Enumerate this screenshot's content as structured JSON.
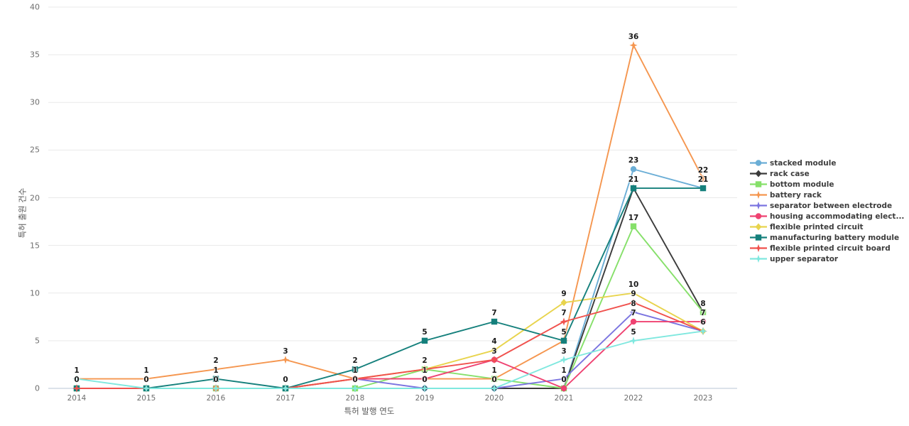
{
  "chart_data": {
    "type": "line",
    "title": "",
    "xlabel": "특허 발행 연도",
    "ylabel": "특허 출원 건수",
    "categories": [
      "2014",
      "2015",
      "2016",
      "2017",
      "2018",
      "2019",
      "2020",
      "2021",
      "2022",
      "2023"
    ],
    "x": [
      2014,
      2015,
      2016,
      2017,
      2018,
      2019,
      2020,
      2021,
      2022,
      2023
    ],
    "ylim": [
      0,
      40
    ],
    "yticks": [
      0,
      5,
      10,
      15,
      20,
      25,
      30,
      35,
      40
    ],
    "grid": true,
    "legend_position": "right",
    "series": [
      {
        "name": "stacked module",
        "color": "#6baed6",
        "marker": "circle",
        "values": [
          0,
          0,
          0,
          0,
          0,
          0,
          0,
          0,
          23,
          21
        ]
      },
      {
        "name": "rack case",
        "color": "#3b3b3b",
        "marker": "diamond",
        "values": [
          0,
          0,
          0,
          0,
          0,
          0,
          0,
          0,
          21,
          8
        ]
      },
      {
        "name": "bottom module",
        "color": "#86e06a",
        "marker": "square",
        "values": [
          0,
          0,
          0,
          0,
          0,
          2,
          1,
          0,
          17,
          8
        ]
      },
      {
        "name": "battery rack",
        "color": "#f5964f",
        "marker": "star",
        "values": [
          1,
          1,
          2,
          3,
          1,
          1,
          1,
          5,
          36,
          22
        ]
      },
      {
        "name": "separator between electrode",
        "color": "#7b74e0",
        "marker": "star",
        "values": [
          0,
          0,
          0,
          0,
          1,
          0,
          0,
          1,
          8,
          6
        ]
      },
      {
        "name": "housing accommodating elect...",
        "color": "#ef4271",
        "marker": "circle",
        "values": [
          0,
          0,
          0,
          0,
          1,
          1,
          3,
          0,
          7,
          7
        ]
      },
      {
        "name": "flexible printed circuit",
        "color": "#e8d44d",
        "marker": "diamond",
        "values": [
          0,
          0,
          0,
          0,
          1,
          2,
          4,
          9,
          10,
          6
        ]
      },
      {
        "name": "manufacturing battery module",
        "color": "#15807c",
        "marker": "square",
        "values": [
          0,
          0,
          1,
          0,
          2,
          5,
          7,
          5,
          21,
          21
        ]
      },
      {
        "name": "flexible printed circuit board",
        "color": "#f0514d",
        "marker": "star",
        "values": [
          0,
          0,
          0,
          0,
          1,
          2,
          3,
          7,
          9,
          6
        ]
      },
      {
        "name": "upper separator",
        "color": "#7fe8df",
        "marker": "star",
        "values": [
          1,
          0,
          0,
          0,
          0,
          0,
          0,
          3,
          5,
          6
        ]
      }
    ],
    "point_labels": {
      "2014": [
        "1",
        "0"
      ],
      "2015": [
        "1",
        "0"
      ],
      "2016": [
        "2",
        "1",
        "0"
      ],
      "2017": [
        "3",
        "0"
      ],
      "2018": [
        "2",
        "1",
        "0"
      ],
      "2019": [
        "5",
        "2",
        "1",
        "0"
      ],
      "2020": [
        "7",
        "4",
        "3",
        "1",
        "0"
      ],
      "2021": [
        "9",
        "7",
        "5",
        "3",
        "1",
        "0"
      ],
      "2022": [
        "36",
        "23",
        "21",
        "17",
        "10",
        "9",
        "8",
        "7",
        "5"
      ],
      "2023": [
        "22",
        "21",
        "8",
        "7",
        "6"
      ]
    }
  },
  "legend": {
    "items": [
      {
        "label": "stacked module"
      },
      {
        "label": "rack case"
      },
      {
        "label": "bottom module"
      },
      {
        "label": "battery rack"
      },
      {
        "label": "separator between electrode"
      },
      {
        "label": "housing accommodating elect..."
      },
      {
        "label": "flexible printed circuit"
      },
      {
        "label": "manufacturing battery module"
      },
      {
        "label": "flexible printed circuit board"
      },
      {
        "label": "upper separator"
      }
    ]
  }
}
